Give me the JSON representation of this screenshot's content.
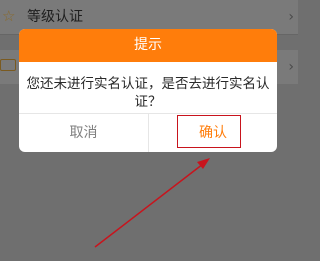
{
  "background_list": {
    "items": [
      {
        "label": "等级认证",
        "icon": "star-outline-icon"
      },
      {
        "label": "",
        "icon": "card-icon"
      }
    ],
    "arrow_glyph": "›"
  },
  "dialog": {
    "title": "提示",
    "message": "您还未进行实名认证，是否去进行实名认证？",
    "cancel_label": "取消",
    "confirm_label": "确认"
  },
  "annotation": {
    "highlight_target": "confirm-button",
    "color": "#c8141d"
  },
  "colors": {
    "accent": "#ff7d0b",
    "overlay": "#6f6f6f"
  }
}
